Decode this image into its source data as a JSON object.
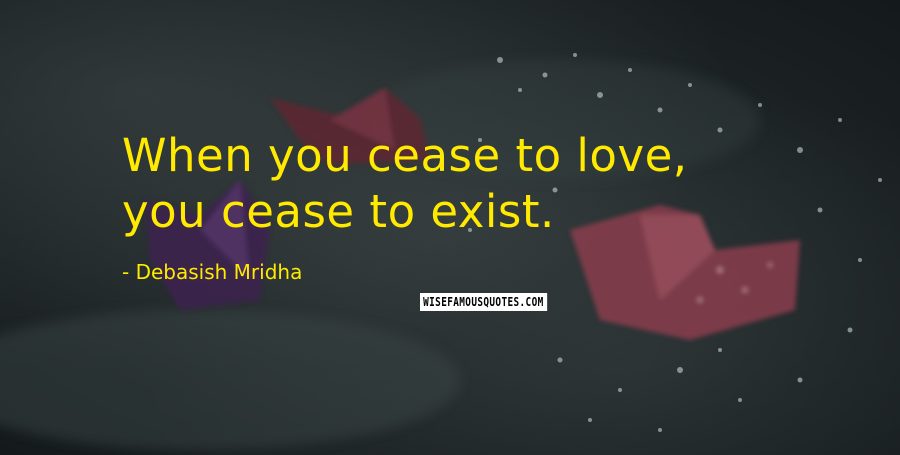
{
  "quote": {
    "lines": [
      "When you cease to love,",
      "you cease to exist."
    ],
    "color": "#ffea00"
  },
  "author": {
    "text": "- Debasish Mridha"
  },
  "watermark": {
    "text": "WISEFAMOUSQUOTES.COM"
  },
  "background": {
    "boat_colors": [
      "#6a2a3a",
      "#4a2a5a",
      "#9a4a5a"
    ]
  }
}
